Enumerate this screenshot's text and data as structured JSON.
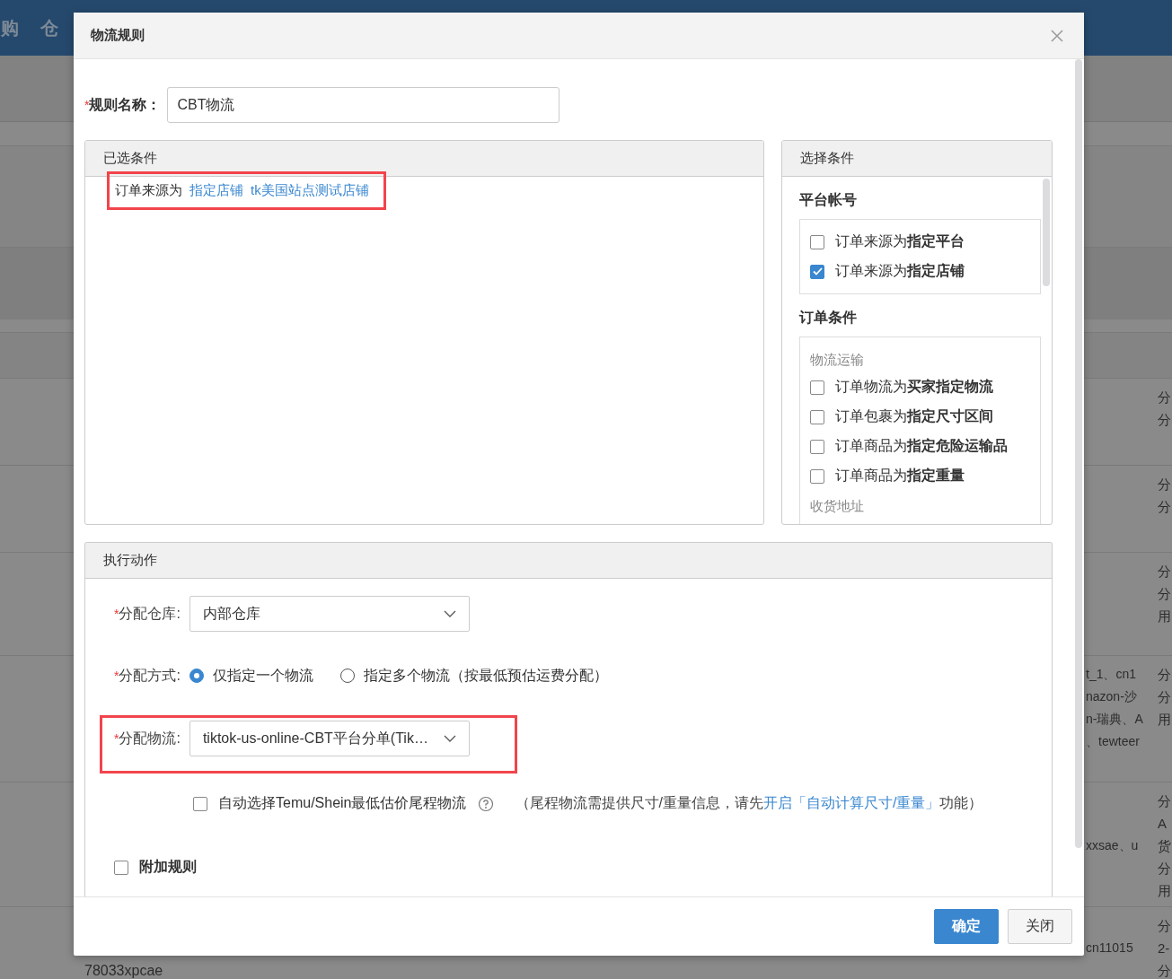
{
  "background": {
    "nav": [
      {
        "label": "购"
      },
      {
        "label": "仓"
      }
    ],
    "table": {
      "rows": [
        {
          "column_3": [
            "分",
            "分"
          ]
        },
        {
          "column_3": [
            "分",
            "分"
          ]
        },
        {
          "column_3": [
            "分",
            "分",
            "用"
          ]
        },
        {
          "column_2": [
            "t_1、cn1",
            "nazon-沙",
            "n-瑞典、A",
            "、tewteer"
          ],
          "column_3": [
            "分",
            "分",
            "用"
          ]
        },
        {
          "column_2": [
            "xxsae、u"
          ],
          "column_3": [
            "分",
            "A",
            "货",
            "分",
            "用"
          ]
        },
        {
          "column_1": [
            "78033xpcae"
          ],
          "column_2": [
            "cn11015"
          ],
          "column_3": [
            "分",
            "2-",
            "分"
          ]
        }
      ]
    }
  },
  "dialog": {
    "title": "物流规则",
    "rule_name": {
      "mark": "*",
      "label": "规则名称：",
      "value": "CBT物流"
    },
    "selected_conditions": {
      "title": "已选条件",
      "items": [
        {
          "prefix": "订单来源为",
          "links": [
            "指定店铺",
            "tk美国站点测试店铺"
          ],
          "highlighted": true
        }
      ]
    },
    "choose_conditions": {
      "title": "选择条件",
      "groups": [
        {
          "title": "平台帐号",
          "sections": [
            {
              "items": [
                {
                  "text": "订单来源为**指定平台**",
                  "checked": false
                },
                {
                  "text": "订单来源为**指定店铺**",
                  "checked": true
                }
              ]
            }
          ]
        },
        {
          "title": "订单条件",
          "sections": [
            {
              "heading": "物流运输",
              "items": [
                {
                  "text": "订单物流为**买家指定物流**",
                  "checked": false
                },
                {
                  "text": "订单包裹为**指定尺寸区间**",
                  "checked": false
                },
                {
                  "text": "订单商品为**指定危险运输品**",
                  "checked": false
                },
                {
                  "text": "订单商品为**指定重量**",
                  "checked": false
                }
              ]
            },
            {
              "heading": "收货地址"
            }
          ]
        }
      ]
    },
    "actions": {
      "title": "执行动作",
      "warehouse": {
        "mark": "*",
        "label": "分配仓库:",
        "value": "内部仓库"
      },
      "method": {
        "mark": "*",
        "label": "分配方式:",
        "options": [
          {
            "label": "仅指定一个物流",
            "selected": true
          },
          {
            "label": "指定多个物流（按最低预估运费分配）",
            "selected": false
          }
        ]
      },
      "logistics": {
        "mark": "*",
        "label": "分配物流:",
        "value": "tiktok-us-online-CBT平台分单(Tik…",
        "highlighted": true
      },
      "auto_select": {
        "label": "自动选择Temu/Shein最低估价尾程物流",
        "checked": false,
        "note_before": "（尾程物流需提供尺寸/重量信息，请先",
        "note_link": "开启「自动计算尺寸/重量」",
        "note_after": "功能）"
      },
      "extra_rule": {
        "label": "附加规则",
        "checked": false
      }
    },
    "buttons": [
      {
        "label": "确定",
        "kind": "primary"
      },
      {
        "label": "关闭",
        "kind": "default"
      }
    ]
  }
}
